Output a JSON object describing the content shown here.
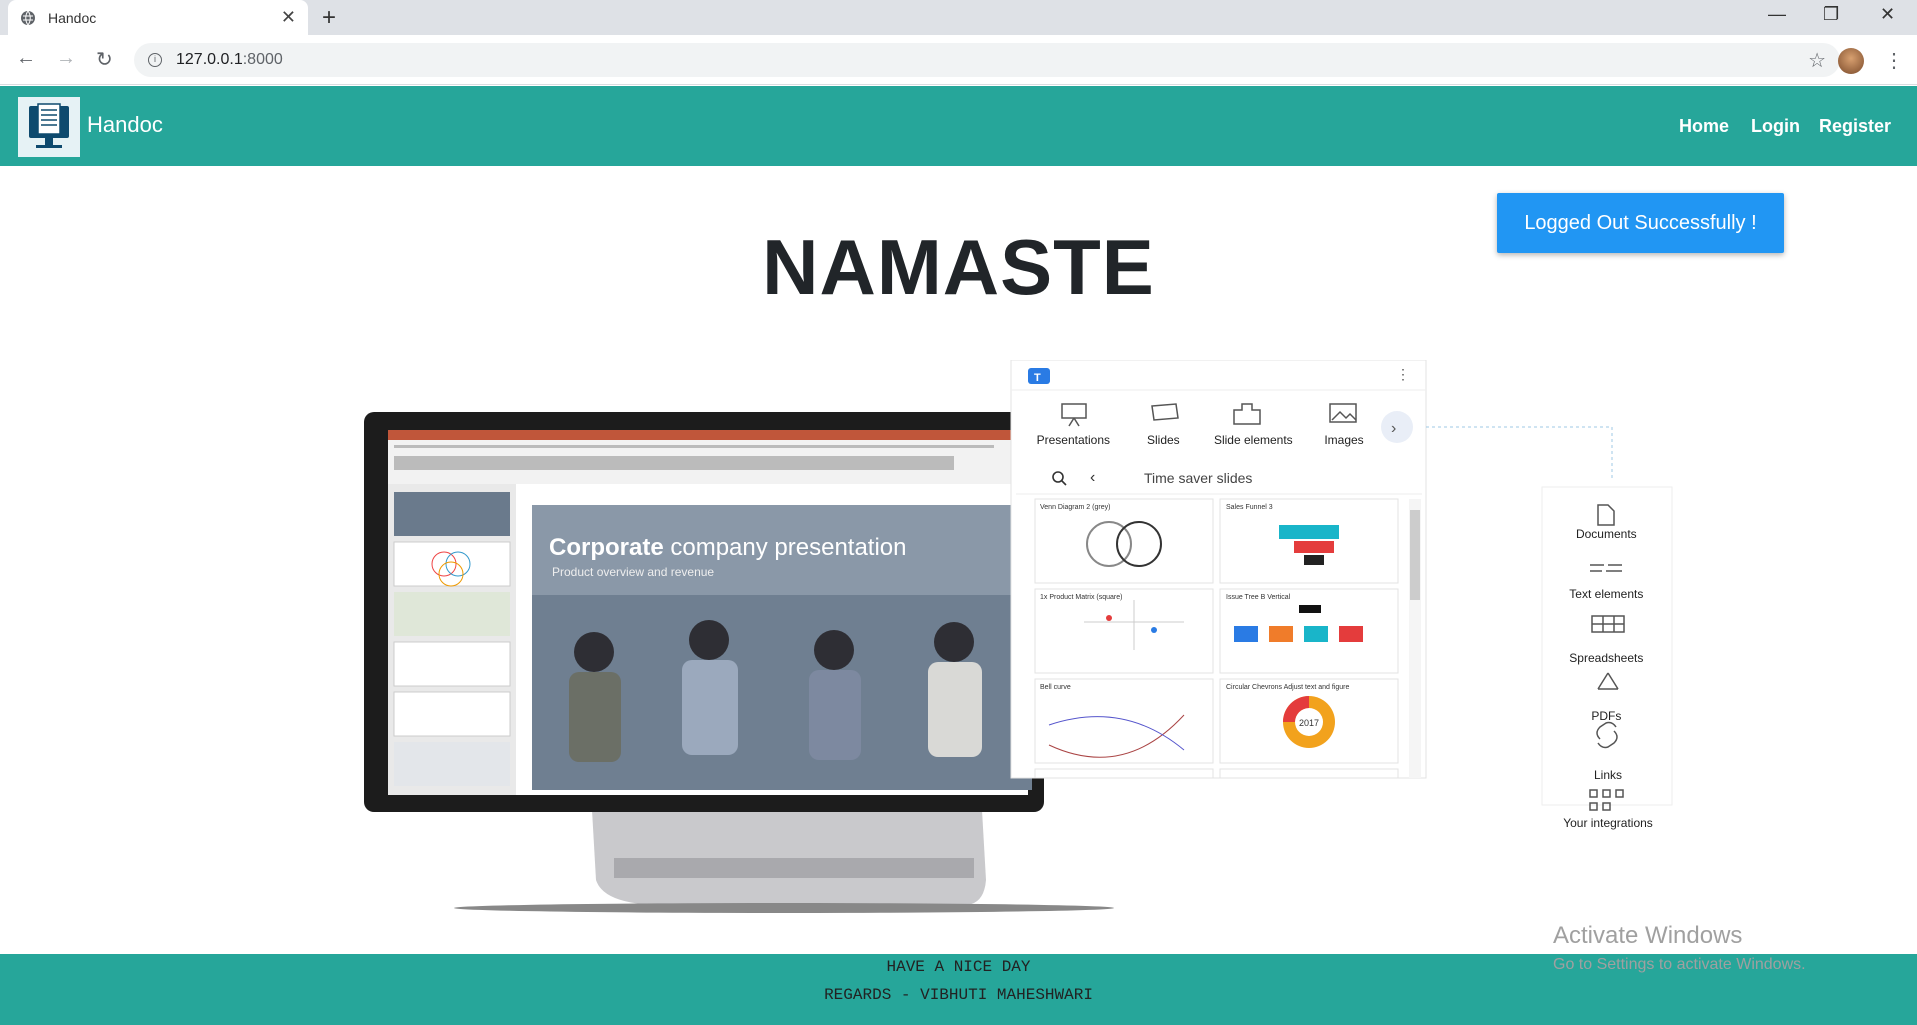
{
  "browser": {
    "tab_title": "Handoc",
    "url_host": "127.0.0.1",
    "url_port": ":8000"
  },
  "nav": {
    "brand": "Handoc",
    "links": [
      "Home",
      "Login",
      "Register"
    ]
  },
  "toast": "Logged Out Successfully !",
  "heading": "NAMASTE",
  "hero": {
    "slide_title_bold": "Corporate",
    "slide_title_rest": " company presentation",
    "slide_subtitle": "Product overview and revenue",
    "panel_tabs": [
      "Presentations",
      "Slides",
      "Slide elements",
      "Images"
    ],
    "panel_search_label": "Time saver slides",
    "side_items": [
      "Documents",
      "Text elements",
      "Spreadsheets",
      "PDFs",
      "Links",
      "Your integrations"
    ],
    "thumb_labels": [
      "Venn Diagram 2 (grey)",
      "Sales Funnel 3",
      "1x Product Matrix (square)",
      "Issue Tree B Vertical",
      "Bell curve",
      "Circular Chevrons Adjust text and figure"
    ],
    "donut_label": "2017"
  },
  "footer": {
    "line1": "HAVE A NICE DAY",
    "line2": "REGARDS - VIBHUTI MAHESHWARI"
  },
  "watermark": {
    "line1": "Activate Windows",
    "line2": "Go to Settings to activate Windows."
  },
  "colors": {
    "accent": "#26a69a",
    "toast": "#2196f3"
  }
}
